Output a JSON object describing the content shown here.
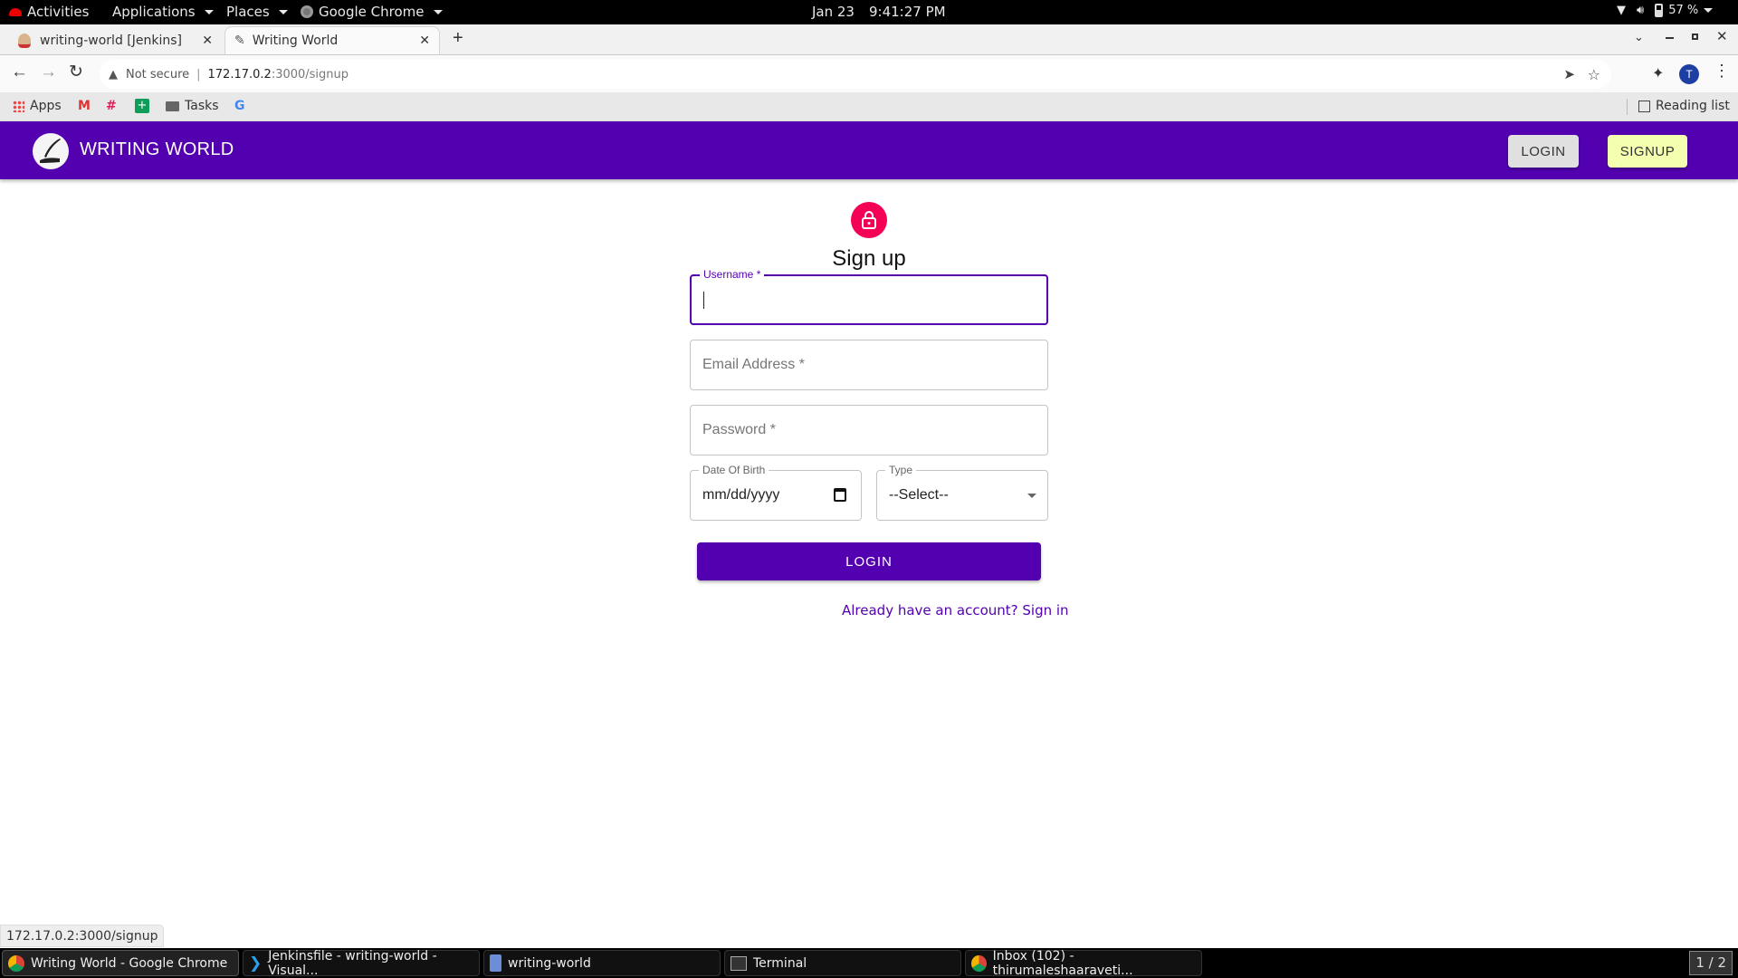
{
  "system_bar": {
    "activities": "Activities",
    "applications": "Applications",
    "places": "Places",
    "active_app": "Google Chrome",
    "date": "Jan 23",
    "time": "9:41:27 PM",
    "battery": "57 %"
  },
  "browser": {
    "tabs": [
      {
        "title": "writing-world [Jenkins]",
        "icon": "jenkins-icon",
        "active": false
      },
      {
        "title": "Writing World",
        "icon": "quill-icon",
        "active": true
      }
    ],
    "security_label": "Not secure",
    "url_host": "172.17.0.2",
    "url_path": ":3000/signup",
    "profile_initial": "T",
    "bookmarks": [
      {
        "label": "Apps",
        "icon": "apps-grid-icon"
      },
      {
        "label": "",
        "icon": "gmail-icon"
      },
      {
        "label": "",
        "icon": "slack-icon"
      },
      {
        "label": "",
        "icon": "sheets-icon"
      },
      {
        "label": "Tasks",
        "icon": "folder-icon"
      },
      {
        "label": "",
        "icon": "google-icon"
      }
    ],
    "reading_list": "Reading list",
    "status_url": "172.17.0.2:3000/signup"
  },
  "app": {
    "brand": "WRITING WORLD",
    "nav_login": "LOGIN",
    "nav_signup": "SIGNUP",
    "colors": {
      "primary": "#5200b0",
      "accent": "#f50057",
      "signup_button": "#f5ffb0"
    }
  },
  "form": {
    "title": "Sign up",
    "username": {
      "label": "Username *",
      "value": ""
    },
    "email": {
      "placeholder": "Email Address *",
      "value": ""
    },
    "password": {
      "placeholder": "Password *",
      "value": ""
    },
    "dob": {
      "label": "Date Of Birth",
      "value": "mm/dd/yyyy"
    },
    "type": {
      "label": "Type",
      "selected": "--Select--"
    },
    "submit": "LOGIN",
    "signin_link": "Already have an account? Sign in"
  },
  "taskbar": {
    "items": [
      {
        "label": "Writing World - Google Chrome",
        "icon": "chrome-icon",
        "active": true
      },
      {
        "label": "Jenkinsfile - writing-world - Visual...",
        "icon": "vscode-icon",
        "active": false
      },
      {
        "label": "writing-world",
        "icon": "file-manager-icon",
        "active": false
      },
      {
        "label": "Terminal",
        "icon": "terminal-icon",
        "active": false
      },
      {
        "label": "Inbox (102) - thirumaleshaaraveti...",
        "icon": "chrome-icon",
        "active": false
      }
    ],
    "workspace": "1 / 2"
  }
}
